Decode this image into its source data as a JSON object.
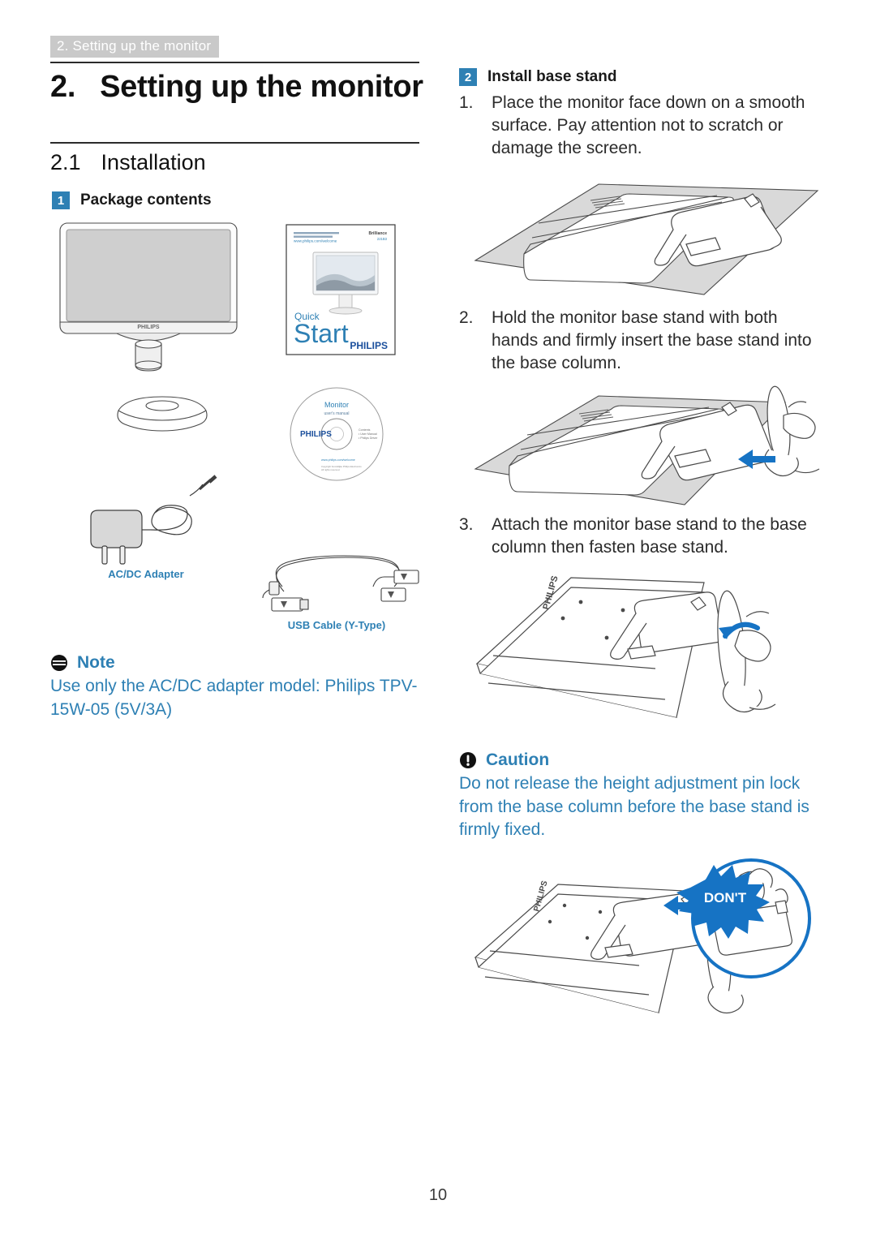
{
  "header": {
    "running_head": "2. Setting up the monitor"
  },
  "chapter": {
    "number": "2.",
    "title": "Setting up the monitor"
  },
  "section": {
    "number": "2.1",
    "title": "Installation"
  },
  "left_column": {
    "subsection": {
      "badge": "1",
      "title": "Package contents"
    },
    "items": [
      {
        "name": "monitor-illustration",
        "label": ""
      },
      {
        "name": "quick-start-guide",
        "label": ""
      },
      {
        "name": "base-stand-illustration",
        "label": ""
      },
      {
        "name": "cd-illustration",
        "label": ""
      },
      {
        "name": "ac-dc-adapter",
        "label": "AC/DC Adapter"
      },
      {
        "name": "usb-cable",
        "label": "USB Cable (Y-Type)"
      }
    ],
    "quick_start_cover": {
      "url_line": "www.philips.com/welcome",
      "brand_small": "Brilliance",
      "word1": "Quick",
      "word2": "Start",
      "logo": "PHILIPS"
    },
    "cd_label": {
      "line1": "Monitor",
      "line2": "user's manual",
      "logo": "PHILIPS"
    },
    "monitor_logo": "PHILIPS",
    "note": {
      "icon": "note-icon",
      "title": "Note",
      "body": "Use only the AC/DC adapter model: Philips TPV-15W-05 (5V/3A)"
    }
  },
  "right_column": {
    "subsection": {
      "badge": "2",
      "title": "Install base stand"
    },
    "steps": [
      {
        "number": "1.",
        "text": "Place the monitor face down on a smooth surface. Pay attention not to scratch or damage the screen."
      },
      {
        "number": "2.",
        "text": "Hold the monitor base stand with both hands and firmly insert the base stand into the base column."
      },
      {
        "number": "3.",
        "text": "Attach the monitor base stand to the base column then fasten base stand."
      }
    ],
    "caution": {
      "icon": "caution-icon",
      "title": "Caution",
      "body": "Do not release the height adjustment pin lock from the base column before the base stand is firmly fixed."
    },
    "dont_badge": "DON'T",
    "stand_logo": "PHILIPS"
  },
  "footer": {
    "page_number": "10"
  },
  "colors": {
    "accent_blue": "#2e80b4",
    "arrow_blue": "#1673c4",
    "runhead_gray": "#c9c9c9",
    "line_art": "#3a3a3a",
    "panel_fill": "#d6d6d6"
  }
}
